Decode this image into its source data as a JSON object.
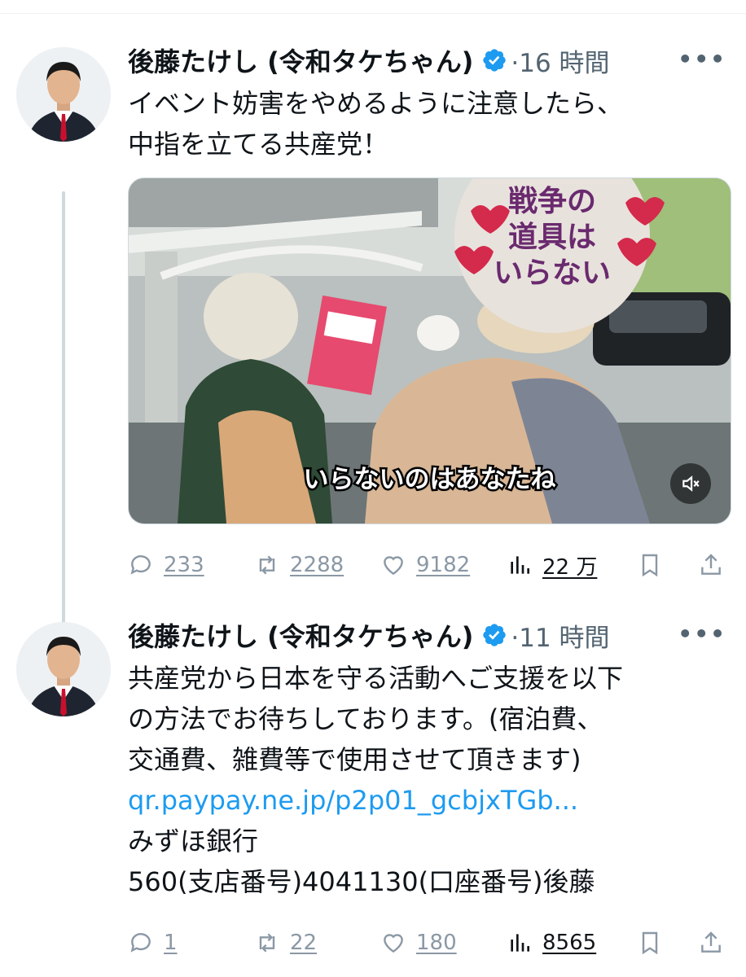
{
  "tweets": [
    {
      "author": "後藤たけし (令和タケちゃん)",
      "time": "·16 時間",
      "text": "イベント妨害をやめるように注意したら、\n中指を立てる共産党！",
      "video_caption": "いらないのはあなたね",
      "sign_text": "戦争の\n道具は\nいらない",
      "stats": {
        "replies": "233",
        "retweets": "2288",
        "likes": "9182",
        "views": "22 万"
      }
    },
    {
      "author": "後藤たけし (令和タケちゃん)",
      "time": "·11 時間",
      "text": "共産党から日本を守る活動へご支援を以下\nの方法でお待ちしております。(宿泊費、\n交通費、雑費等で使用させて頂きます)",
      "link": "qr.paypay.ne.jp/p2p01_gcbjxTGb...",
      "text2": "みずほ銀行\n560(支店番号)4041130(口座番号)後藤",
      "stats": {
        "replies": "1",
        "retweets": "22",
        "likes": "180",
        "views": "8565"
      }
    }
  ],
  "icons": {
    "verified": "verified-badge-icon",
    "more": "more-options-icon",
    "reply": "reply-icon",
    "retweet": "retweet-icon",
    "like": "like-icon",
    "views": "views-icon",
    "bookmark": "bookmark-icon",
    "share": "share-icon",
    "mute": "mute-icon"
  },
  "colors": {
    "accent": "#1d9bf0",
    "muted": "#536471",
    "action": "#8b98a5"
  }
}
